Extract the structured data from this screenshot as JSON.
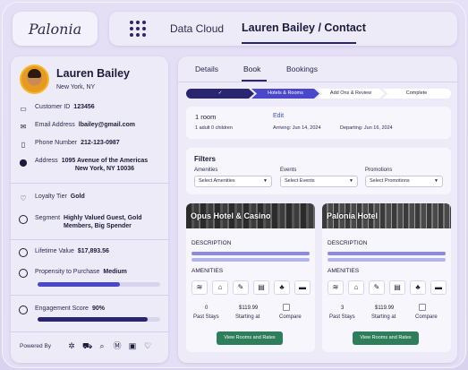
{
  "brand": {
    "logo_text": "Palonia"
  },
  "nav": {
    "item1": "Data Cloud",
    "item2": "Lauren Bailey / Contact"
  },
  "profile": {
    "name": "Lauren Bailey",
    "location": "New York, NY",
    "customer_id_label": "Customer ID",
    "customer_id": "123456",
    "email_label": "Email Address",
    "email": "lbailey@gmail.com",
    "phone_label": "Phone Number",
    "phone": "212-123-0987",
    "address_label": "Address",
    "address_line1": "1095 Avenue of the Americas",
    "address_line2": "New York, NY 10036",
    "loyalty_label": "Loyalty Tier",
    "loyalty": "Gold",
    "segment_label": "Segment",
    "segment_line1": "Highly Valued Guest, Gold",
    "segment_line2": "Members, Big Spender",
    "ltv_label": "Lifetime Value",
    "ltv": "$17,893.56",
    "propensity_label": "Propensity to Purchase",
    "propensity": "Medium",
    "propensity_fill": 0.67,
    "engagement_label": "Engagement Score",
    "engagement": "90%",
    "engagement_fill": 0.9,
    "powered_by": "Powered By"
  },
  "tabs": {
    "details": "Details",
    "book": "Book",
    "bookings": "Bookings"
  },
  "steps": {
    "s1": "✓",
    "s2": "Hotels & Rooms",
    "s3": "Add Ons & Review",
    "s4": "Complete"
  },
  "room": {
    "count": "1 room",
    "occupancy": "1 adult   0 children",
    "edit": "Edit",
    "arriving": "Arriving: Jun 14, 2024",
    "departing": "Departing: Jun 16, 2024"
  },
  "filters": {
    "title": "Filters",
    "amenities_label": "Amenities",
    "amenities_placeholder": "Select Amenities",
    "events_label": "Events",
    "events_placeholder": "Select Events",
    "promotions_label": "Promotions",
    "promotions_placeholder": "Select Promotions"
  },
  "hotels": [
    {
      "name": "Opus Hotel & Casino",
      "description_label": "DESCRIPTION",
      "amenities_label": "AMENITIES",
      "past_stays": "0",
      "past_stays_label": "Past Stays",
      "price": "$119.99",
      "price_label": "Starting at",
      "compare_label": "Compare",
      "button": "View Rooms and Rates"
    },
    {
      "name": "Palonia Hotel",
      "description_label": "DESCRIPTION",
      "amenities_label": "AMENITIES",
      "past_stays": "3",
      "past_stays_label": "Past Stays",
      "price": "$119.99",
      "price_label": "Starting at",
      "compare_label": "Compare",
      "button": "View Rooms and Rates"
    }
  ],
  "colors": {
    "primary": "#2a2570",
    "accent": "#4a47c9",
    "button_green": "#2e7d5b"
  }
}
